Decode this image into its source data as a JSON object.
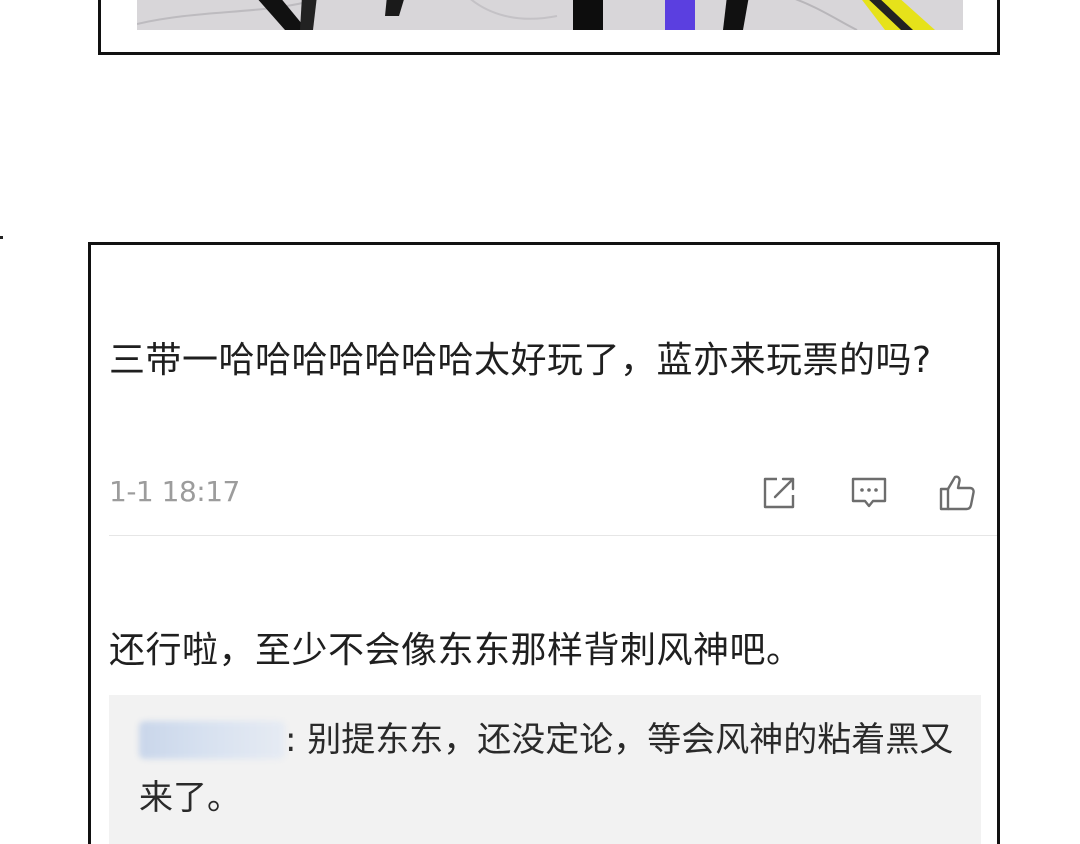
{
  "comment_1": {
    "text": "三带一哈哈哈哈哈哈哈太好玩了，蓝亦来玩票的吗?",
    "timestamp": "1-1 18:17"
  },
  "actions": {
    "share_icon": "share-icon",
    "reply_icon": "comment-icon",
    "like_icon": "thumbs-up-icon"
  },
  "comment_2": {
    "text": "还行啦，至少不会像东东那样背刺风神吧。"
  },
  "reply": {
    "separator": ":",
    "text": " 别提东东，还没定论，等会风神的粘着黑又来了。"
  },
  "colors": {
    "text": "#1f1f1f",
    "meta": "#9c9c9c",
    "reply_bg": "#f2f2f2",
    "border": "#111111"
  }
}
